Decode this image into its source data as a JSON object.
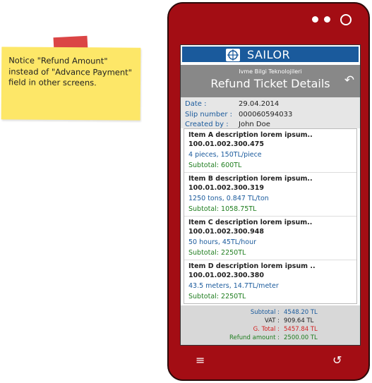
{
  "note": {
    "text": "Notice \"Refund Amount\" instead of \"Advance Payment\" field in other screens."
  },
  "app": {
    "brand": "SAILOR",
    "company": "Ivme Bilgi Teknolojileri",
    "title": "Refund Ticket Details",
    "back_icon": "back-arrow-icon"
  },
  "meta": {
    "date_label": "Date :",
    "date_value": "29.04.2014",
    "slip_label": "Slip number :",
    "slip_value": "000060594033",
    "created_label": "Created by :",
    "created_value": "John Doe"
  },
  "items": [
    {
      "desc": "Item A description lorem ipsum..",
      "code": "100.01.002.300.475",
      "qty": "4 pieces, 150TL/piece",
      "subtotal": "Subtotal: 600TL"
    },
    {
      "desc": "Item B description lorem ipsum..",
      "code": "100.01.002.300.319",
      "qty": "1250 tons, 0.847 TL/ton",
      "subtotal": "Subtotal: 1058.75TL"
    },
    {
      "desc": "Item C description lorem ipsum..",
      "code": "100.01.002.300.948",
      "qty": "50 hours, 45TL/hour",
      "subtotal": "Subtotal: 2250TL"
    },
    {
      "desc": "Item D description lorem ipsum ..",
      "code": "100.01.002.300.380",
      "qty": "43.5 meters, 14.7TL/meter",
      "subtotal": "Subtotal: 2250TL"
    }
  ],
  "totals": {
    "subtotal_label": "Subtotal :",
    "subtotal_value": "4548.20 TL",
    "vat_label": "VAT :",
    "vat_value": "909.64 TL",
    "gtotal_label": "G. Total :",
    "gtotal_value": "5457.84 TL",
    "refund_label": "Refund amount :",
    "refund_value": "2500.00 TL"
  },
  "colors": {
    "phone": "#a30d14",
    "brand": "#1a5a9c",
    "green": "#1e7d1e",
    "red": "#d42020",
    "note": "#fde768"
  }
}
